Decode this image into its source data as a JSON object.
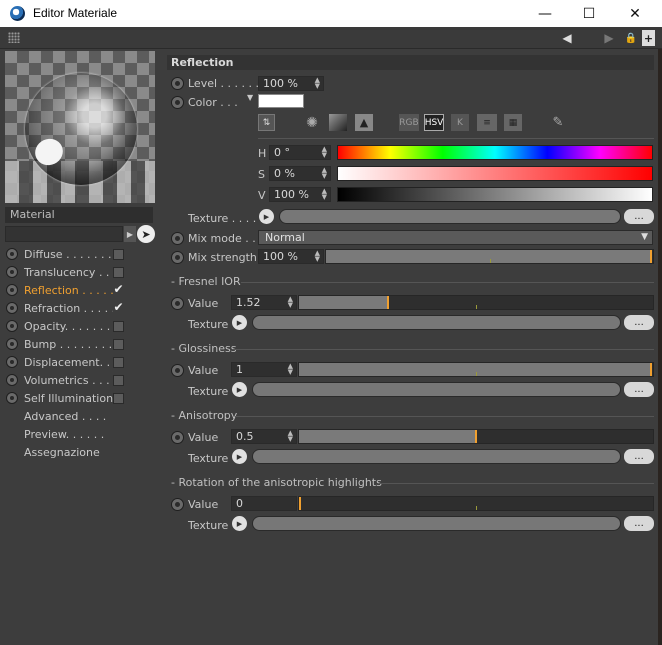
{
  "window": {
    "title": "Editor Materiale",
    "minimize": "—",
    "maximize": "☐",
    "close": "✕"
  },
  "toolbar": {
    "back": "◀",
    "forward": "▶",
    "lock": "🔒",
    "newwin": "+"
  },
  "left": {
    "material_label": "Material",
    "channels": [
      {
        "label": "Diffuse . . . . . . . .",
        "checked": false,
        "active": false
      },
      {
        "label": "Translucency . . . .",
        "checked": false,
        "active": false
      },
      {
        "label": "Reflection . . . . . .",
        "checked": true,
        "active": true
      },
      {
        "label": "Refraction . . . . . .",
        "checked": true,
        "active": false
      },
      {
        "label": "Opacity. . . . . . . . .",
        "checked": false,
        "active": false
      },
      {
        "label": "Bump . . . . . . . . . .",
        "checked": false,
        "active": false
      },
      {
        "label": "Displacement. . . .",
        "checked": false,
        "active": false
      },
      {
        "label": "Volumetrics . . . . .",
        "checked": false,
        "active": false
      },
      {
        "label": "Self Illumination",
        "checked": false,
        "active": false
      }
    ],
    "extras": [
      "Advanced . . . .",
      "Preview. . . . . .",
      "Assegnazione"
    ]
  },
  "reflection": {
    "header": "Reflection",
    "level_label": "Level . . . . . . .",
    "level_value": "100 %",
    "color_label": "Color . . .",
    "color_hex": "#ffffff",
    "picker_icons": [
      "RGB",
      "HSV",
      "K"
    ],
    "h_label": "H",
    "h_value": "0 °",
    "s_label": "S",
    "s_value": "0 %",
    "v_label": "V",
    "v_value": "100 %",
    "texture_label": "Texture . . . . .",
    "ellipsis": "...",
    "mix_mode_label": "Mix mode . . .",
    "mix_mode_value": "Normal",
    "mix_strength_label": "Mix strength",
    "mix_strength_value": "100 %",
    "mix_strength_fraction": 1.0
  },
  "fresnel": {
    "header": "Fresnel IOR",
    "value_label": "Value",
    "value": "1.52",
    "fraction": 0.25,
    "texture_label": "Texture"
  },
  "glossiness": {
    "header": "Glossiness",
    "value_label": "Value",
    "value": "1",
    "fraction": 1.0,
    "texture_label": "Texture"
  },
  "anisotropy": {
    "header": "Anisotropy",
    "value_label": "Value",
    "value": "0.5",
    "fraction": 0.5,
    "texture_label": "Texture"
  },
  "rotation": {
    "header": "Rotation of the anisotropic highlights",
    "value_label": "Value",
    "value": "0",
    "fraction": 0.0,
    "texture_label": "Texture"
  },
  "colors": {
    "accent": "#f0a030",
    "panel": "#3d3d3d",
    "field": "#2f2f2f"
  }
}
